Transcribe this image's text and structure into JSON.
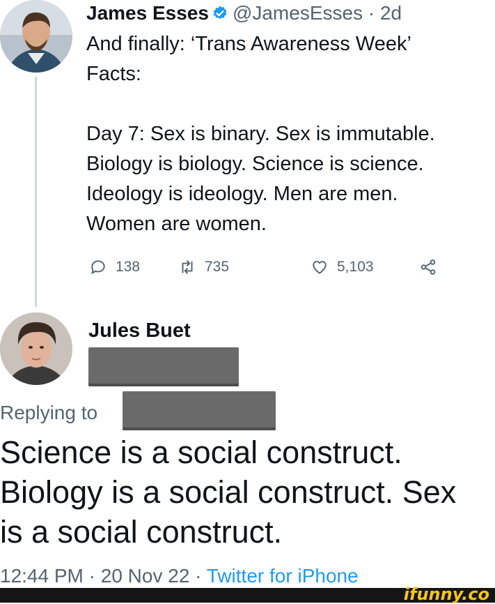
{
  "tweet1": {
    "name": "James Esses",
    "handle": "@JamesEsses",
    "separator": "·",
    "age": "2d",
    "text": "And finally: ‘Trans Awareness Week’\nFacts:\n\nDay 7: Sex is binary. Sex is immutable.\nBiology is biology. Science is science.\nIdeology is ideology. Men are men.\nWomen are women.",
    "replies": "138",
    "retweets": "735",
    "likes": "5,103"
  },
  "tweet2": {
    "name": "Jules Buet",
    "replying_label": "Replying to",
    "text": "Science is a social construct.\nBiology is a social construct. Sex\nis a social construct.",
    "time": "12:44 PM",
    "sep": " · ",
    "date": "20 Nov 22",
    "source": "Twitter for iPhone"
  },
  "watermark": {
    "text": "ifunny.co"
  },
  "colors": {
    "text": "#0f1419",
    "secondary": "#536471",
    "link": "#1d9bf0",
    "verified": "#1d9bf0",
    "redaction": "#6a6a6a"
  },
  "icons": {
    "reply": "reply-icon",
    "retweet": "retweet-icon",
    "like": "heart-icon",
    "share": "share-icon",
    "verified": "verified-badge-icon"
  }
}
